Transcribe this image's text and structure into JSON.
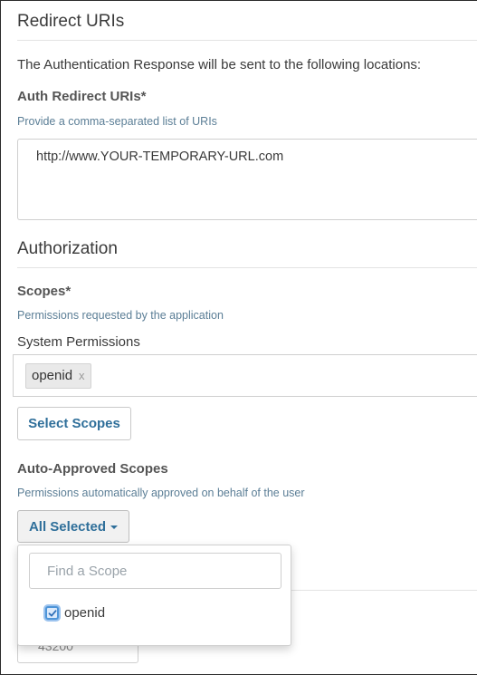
{
  "redirect_section": {
    "title": "Redirect URIs",
    "description": "The Authentication Response will be sent to the following locations:",
    "auth_redirect_label": "Auth Redirect URIs*",
    "auth_redirect_help": "Provide a comma-separated list of URIs",
    "auth_redirect_value": "http://www.YOUR-TEMPORARY-URL.com"
  },
  "authorization_section": {
    "title": "Authorization",
    "scopes_label": "Scopes*",
    "scopes_help": "Permissions requested by the application",
    "system_permissions_label": "System Permissions",
    "selected_scopes": [
      "openid"
    ],
    "tag_remove_glyph": "x",
    "select_scopes_button": "Select Scopes",
    "auto_approved_label": "Auto-Approved Scopes",
    "auto_approved_help": "Permissions automatically approved on behalf of the user",
    "auto_approved_dropdown_label": "All Selected"
  },
  "scope_dropdown": {
    "search_placeholder": "Find a Scope",
    "options": [
      {
        "label": "openid",
        "checked": true
      }
    ]
  },
  "partially_hidden_field": {
    "value": "43200"
  },
  "colors": {
    "help_text": "#5b7e96",
    "button_text": "#2f6f9a",
    "checkbox_accent": "#4f95d8"
  },
  "icons": {
    "dropdown_caret": "caret-down-icon",
    "checkbox_check": "check-icon",
    "tag_remove": "close-icon"
  }
}
